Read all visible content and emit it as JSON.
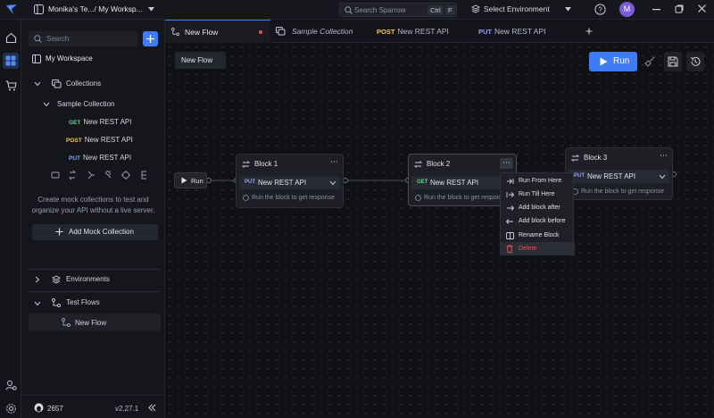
{
  "topbar": {
    "workspace_title": "Monika's Te.../ My Worksp...",
    "search_placeholder": "Search Sparrow",
    "shortcut_key1": "Ctrl",
    "shortcut_key2": "F",
    "environment_label": "Select Environment",
    "avatar_initial": "M"
  },
  "sidebar": {
    "search_placeholder": "Search",
    "workspace_label": "My Workspace",
    "collections_label": "Collections",
    "collection_name": "Sample Collection",
    "requests": [
      {
        "method": "GET",
        "name": "New REST API"
      },
      {
        "method": "POST",
        "name": "New REST API"
      },
      {
        "method": "PUT",
        "name": "New REST API"
      }
    ],
    "mock_text_line1": "Create mock collections to test and",
    "mock_text_line2": "organize your API without a live server.",
    "add_mock_label": "Add Mock Collection",
    "environments_label": "Environments",
    "test_flows_label": "Test Flows",
    "flow_item_label": "New Flow",
    "github_stars": "2657",
    "version": "v2.27.1"
  },
  "tabs": [
    {
      "method": "",
      "label": "New Flow"
    },
    {
      "method": "",
      "label": "Sample Collection"
    },
    {
      "method": "POST",
      "label": "New REST API"
    },
    {
      "method": "PUT",
      "label": "New REST API"
    }
  ],
  "canvas": {
    "flow_name": "New Flow",
    "run_button_label": "Run",
    "start_node_label": "Run",
    "blocks": [
      {
        "title": "Block 1",
        "method": "PUT",
        "request": "New REST API",
        "hint": "Run the block to get response"
      },
      {
        "title": "Block 2",
        "method": "GET",
        "request": "New REST API",
        "hint": "Run the block to get response"
      },
      {
        "title": "Block 3",
        "method": "PUT",
        "request": "New REST API",
        "hint": "Run the block to get response"
      }
    ],
    "context_menu": [
      {
        "label": "Run From Here",
        "icon": "run-from-here-icon"
      },
      {
        "label": "Run Till Here",
        "icon": "run-till-here-icon"
      },
      {
        "label": "Add block after",
        "icon": "add-after-icon"
      },
      {
        "label": "Add block before",
        "icon": "add-before-icon"
      },
      {
        "label": "Rename Block",
        "icon": "rename-icon"
      },
      {
        "label": "Delete",
        "icon": "trash-icon"
      }
    ]
  },
  "colors": {
    "accent": "#3f7bf5",
    "get": "#6fcf97",
    "post": "#f2c94c",
    "put": "#8aa4ff",
    "danger": "#e5534b",
    "avatar": "#7b5cd6"
  }
}
